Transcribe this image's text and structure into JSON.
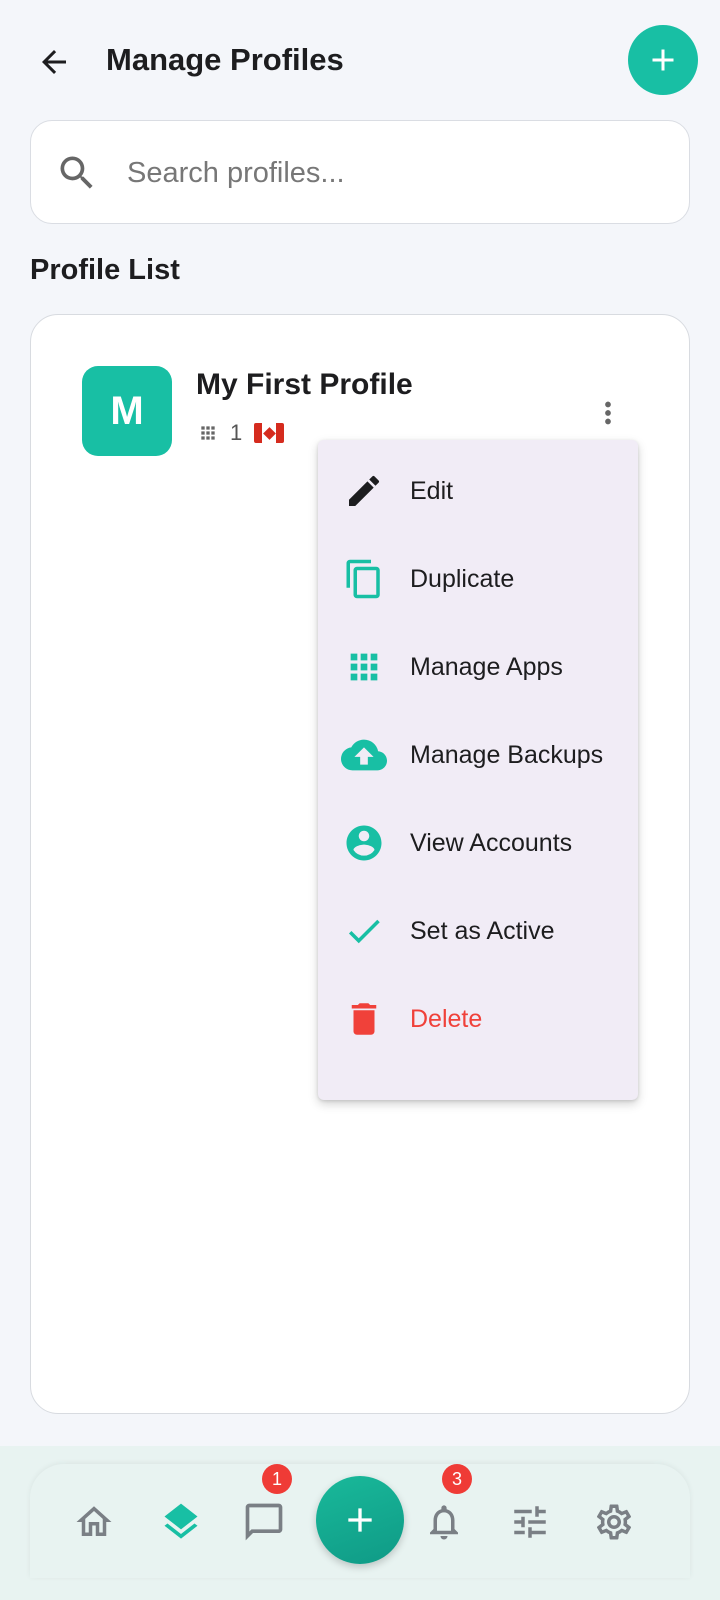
{
  "header": {
    "title": "Manage Profiles"
  },
  "search": {
    "placeholder": "Search profiles..."
  },
  "section": {
    "title": "Profile List"
  },
  "profile": {
    "avatar_letter": "M",
    "name": "My First Profile",
    "app_count": "1"
  },
  "menu": {
    "items": [
      {
        "label": "Edit",
        "icon": "pencil-icon"
      },
      {
        "label": "Duplicate",
        "icon": "copy-icon"
      },
      {
        "label": "Manage Apps",
        "icon": "apps-grid-icon"
      },
      {
        "label": "Manage Backups",
        "icon": "cloud-upload-icon"
      },
      {
        "label": "View Accounts",
        "icon": "account-circle-icon"
      },
      {
        "label": "Set as Active",
        "icon": "check-icon"
      },
      {
        "label": "Delete",
        "icon": "trash-icon"
      }
    ]
  },
  "bottom_nav": {
    "messages_badge": "1",
    "notifications_badge": "3"
  },
  "colors": {
    "accent": "#18bfa4",
    "danger": "#f0413a",
    "menu_bg": "#f1ecf6"
  }
}
